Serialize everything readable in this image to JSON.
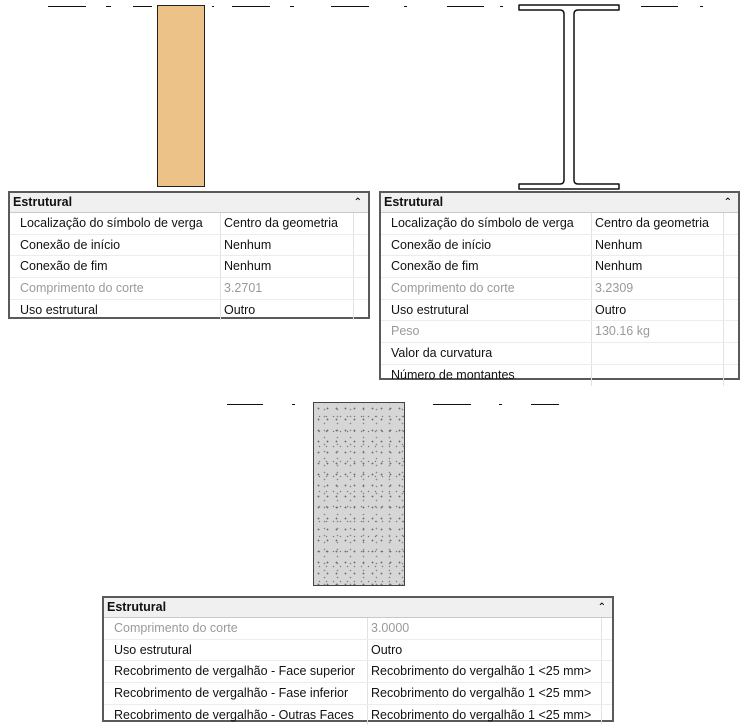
{
  "colors": {
    "wood_fill": "#ecc288",
    "concrete_fill": "#d6d6d6",
    "panel_border": "#5a5a5a",
    "header_background": "#f0f0f0",
    "disabled_text": "#9a9a9a"
  },
  "panels": [
    {
      "title": "Estrutural",
      "collapse_icon": "collapse-up-icon",
      "rows": [
        {
          "name": "Localização do símbolo de verga",
          "value": "Centro da geometria",
          "state": "editable"
        },
        {
          "name": "Conexão de início",
          "value": "Nenhum",
          "state": "editable"
        },
        {
          "name": "Conexão de fim",
          "value": "Nenhum",
          "state": "editable"
        },
        {
          "name": "Comprimento do corte",
          "value": "3.2701",
          "state": "read-only"
        },
        {
          "name": "Uso estrutural",
          "value": "Outro",
          "state": "editable"
        }
      ]
    },
    {
      "title": "Estrutural",
      "collapse_icon": "collapse-up-icon",
      "rows": [
        {
          "name": "Localização do símbolo de verga",
          "value": "Centro da geometria",
          "state": "editable"
        },
        {
          "name": "Conexão de início",
          "value": "Nenhum",
          "state": "editable"
        },
        {
          "name": "Conexão de fim",
          "value": "Nenhum",
          "state": "editable"
        },
        {
          "name": "Comprimento do corte",
          "value": "3.2309",
          "state": "read-only"
        },
        {
          "name": "Uso estrutural",
          "value": "Outro",
          "state": "editable"
        },
        {
          "name": "Peso",
          "value": "130.16 kg",
          "state": "read-only"
        },
        {
          "name": "Valor da curvatura",
          "value": "",
          "state": "editable"
        },
        {
          "name": "Número de montantes",
          "value": "",
          "state": "editable"
        }
      ]
    },
    {
      "title": "Estrutural",
      "collapse_icon": "collapse-up-icon",
      "rows": [
        {
          "name": "Comprimento do corte",
          "value": "3.0000",
          "state": "read-only"
        },
        {
          "name": "Uso estrutural",
          "value": "Outro",
          "state": "editable"
        },
        {
          "name": "Recobrimento de vergalhão - Face superior",
          "value": "Recobrimento do vergalhão 1 <25 mm>",
          "state": "editable"
        },
        {
          "name": "Recobrimento de vergalhão - Fase inferior",
          "value": "Recobrimento do vergalhão 1 <25 mm>",
          "state": "editable"
        },
        {
          "name": "Recobrimento de vergalhão - Outras Faces",
          "value": "Recobrimento do vergalhão 1 <25 mm>",
          "state": "editable"
        }
      ]
    }
  ]
}
